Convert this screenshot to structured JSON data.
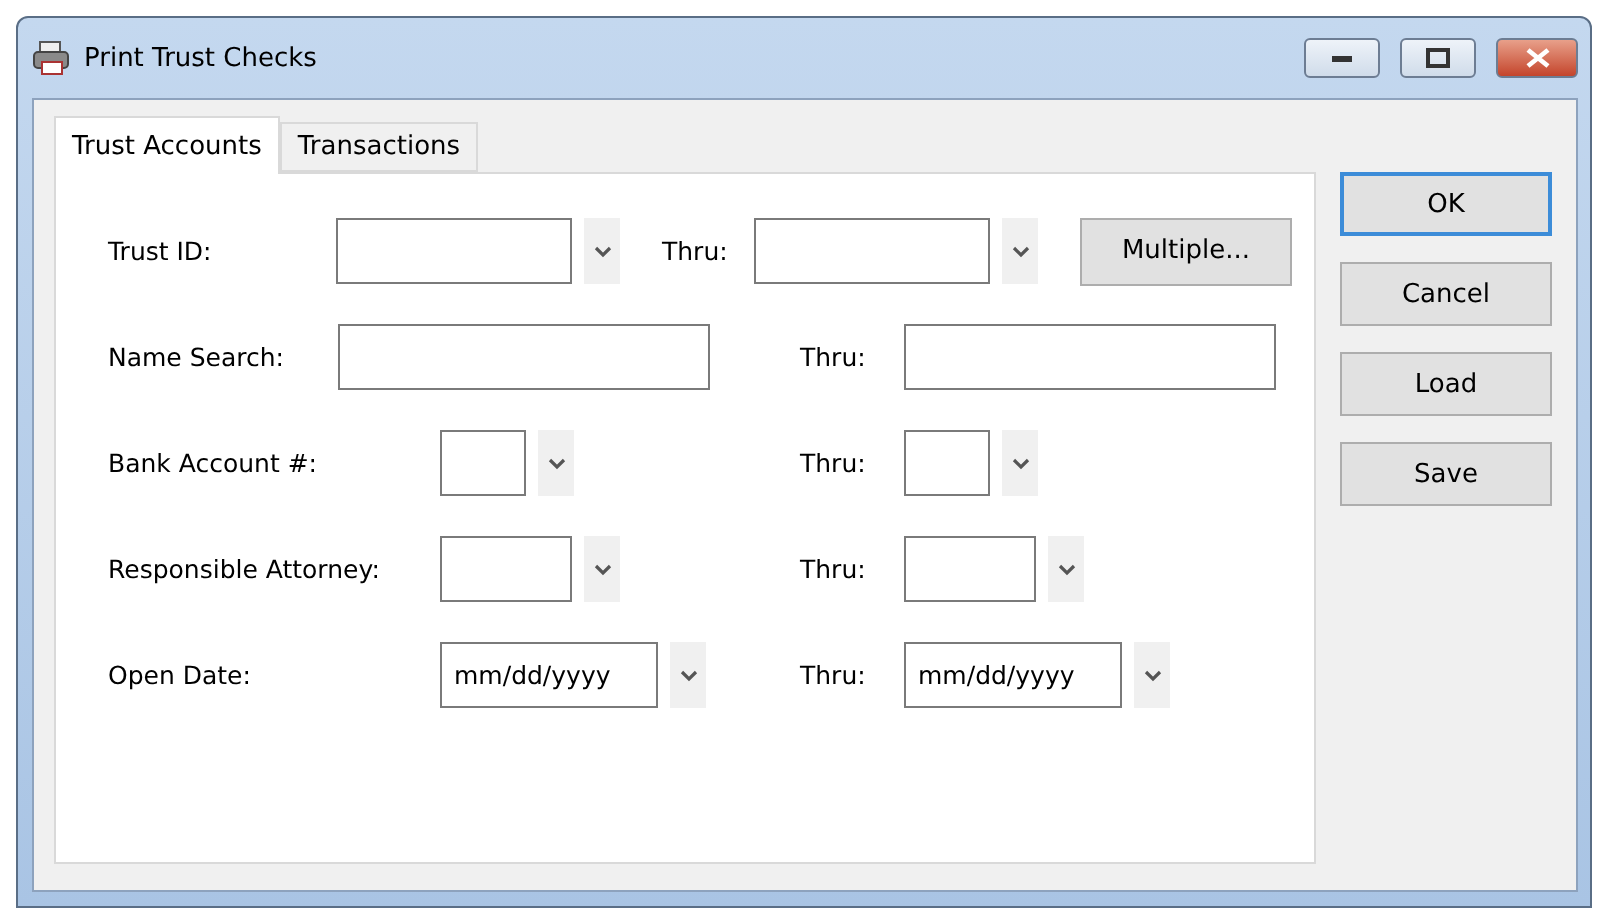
{
  "window": {
    "title": "Print Trust Checks"
  },
  "tabs": [
    {
      "label": "Trust Accounts",
      "selected": true
    },
    {
      "label": "Transactions",
      "selected": false
    }
  ],
  "rows": [
    {
      "label": "Trust ID:",
      "kind": "combo",
      "value": "",
      "thru_label": "Thru:",
      "thru_value": "",
      "button": "Multiple..."
    },
    {
      "label": "Name Search:",
      "kind": "text",
      "value": "",
      "thru_label": "Thru:",
      "thru_value": ""
    },
    {
      "label": "Bank Account #:",
      "kind": "combo",
      "value": "",
      "thru_label": "Thru:",
      "thru_value": ""
    },
    {
      "label": "Responsible Attorney:",
      "kind": "combo",
      "value": "",
      "thru_label": "Thru:",
      "thru_value": ""
    },
    {
      "label": "Open Date:",
      "kind": "combo",
      "value": "mm/dd/yyyy",
      "thru_label": "Thru:",
      "thru_value": "mm/dd/yyyy"
    }
  ],
  "buttons": [
    {
      "label": "OK",
      "focused": true
    },
    {
      "label": "Cancel",
      "focused": false
    },
    {
      "label": "Load",
      "focused": false
    },
    {
      "label": "Save",
      "focused": false
    }
  ]
}
